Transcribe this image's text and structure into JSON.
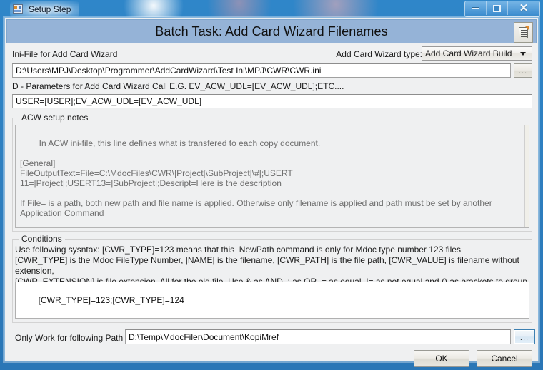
{
  "window": {
    "title": "Setup Step",
    "app_icon": "window-app-icon",
    "controls": {
      "minimize": "minimize-icon",
      "maximize": "maximize-icon",
      "close": "close-icon"
    }
  },
  "header": {
    "title": "Batch Task: Add Card Wizard Filenames",
    "doc_icon": "document-icon",
    "background_color": "#95b3d7"
  },
  "form": {
    "ini_file_label": "Ini-File for Add Card Wizard",
    "ini_file_value": "D:\\Users\\MPJ\\Desktop\\Programmer\\AddCardWizard\\Test Ini\\MPJ\\CWR\\CWR.ini",
    "ini_browse_label": "...",
    "acw_type_label": "Add Card Wizard type:",
    "acw_type_value": "Add Card Wizard Build",
    "params_label": "D - Parameters for Add Card Wizard Call E.G. EV_ACW_UDL=[EV_ACW_UDL];ETC....",
    "params_value": "USER=[USER];EV_ACW_UDL=[EV_ACW_UDL]"
  },
  "notes_group": {
    "title": "ACW setup notes",
    "text": "In ACW ini-file, this line defines what is transfered to each copy document.\n\n[General]\nFileOutputText=File=C:\\MdocFiles\\CWR\\|Project|\\SubProject|\\#|;USERT\n11=|Project|;USERT13=|SubProject|;Descript=Here is the description\n\nIf File= is a path, both new path and file name is applied. Otherwise only filename is applied and path must be set by another Application Command"
  },
  "conditions_group": {
    "title": "Conditions",
    "description": "Use following sysntax: [CWR_TYPE]=123 means that this  NewPath command is only for Mdoc type number 123 files\n[CWR_TYPE] is the Mdoc FileType Number, |NAME| is the filename, [CWR_PATH] is the file path, [CWR_VALUE] is filename without extension,\n[CWR_EXTENSION] is file extension. All for the old file. Use & as AND, ; as OR, = as equal, != as not equal and () as brackets to group conditions",
    "value": "[CWR_TYPE]=123;[CWR_TYPE]=124"
  },
  "path_row": {
    "label": "Only Work for following Path",
    "value": "D:\\Temp\\MdocFiler\\Document\\KopiMref",
    "browse_label": "..."
  },
  "buttons": {
    "ok": "OK",
    "cancel": "Cancel"
  }
}
